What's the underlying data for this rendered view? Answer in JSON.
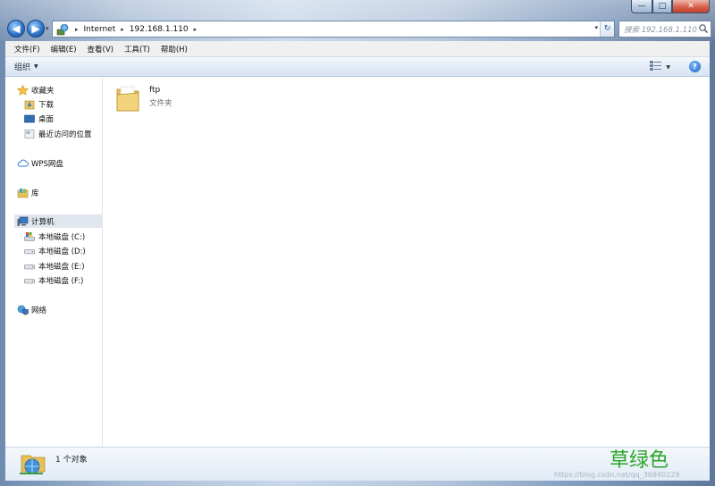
{
  "window": {
    "caption": {
      "minimize": "—",
      "maximize": "□",
      "close": "✕"
    }
  },
  "nav": {
    "back": "◀",
    "forward": "▶",
    "dropdown": "▾"
  },
  "address": {
    "segments": [
      "Internet",
      "192.168.1.110"
    ],
    "separator": "▸",
    "dropdown": "▾",
    "refresh": "↻"
  },
  "search": {
    "placeholder": "搜索 192.168.1.110"
  },
  "menubar": {
    "items": [
      "文件(F)",
      "编辑(E)",
      "查看(V)",
      "工具(T)",
      "帮助(H)"
    ]
  },
  "commandbar": {
    "organize": "组织",
    "organize_caret": "▼",
    "views_caret": "▼",
    "help": "?"
  },
  "navpane": {
    "favorites": {
      "label": "收藏夹",
      "items": [
        "下载",
        "桌面",
        "最近访问的位置"
      ]
    },
    "wps": {
      "label": "WPS网盘"
    },
    "libraries": {
      "label": "库"
    },
    "computer": {
      "label": "计算机",
      "drives": [
        "本地磁盘 (C:)",
        "本地磁盘 (D:)",
        "本地磁盘 (E:)",
        "本地磁盘 (F:)"
      ]
    },
    "network": {
      "label": "网络"
    }
  },
  "content": {
    "items": [
      {
        "name": "ftp",
        "type": "文件夹"
      }
    ]
  },
  "details": {
    "count": "1 个对象"
  },
  "watermark": {
    "text": "草绿色",
    "url": "https://blog.csdn.net/qq_36940229"
  },
  "colors": {
    "accent": "#2a6fc6",
    "selection": "#dfe6ee",
    "watermark": "#2aa52a"
  }
}
